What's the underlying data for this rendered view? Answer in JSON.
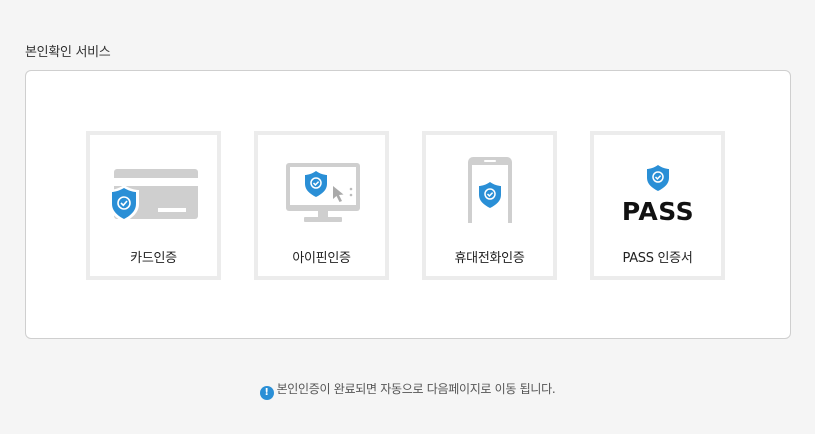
{
  "section_title": "본인확인 서비스",
  "methods": [
    {
      "label": "카드인증",
      "icon": "card-shield-icon"
    },
    {
      "label": "아이핀인증",
      "icon": "monitor-shield-icon"
    },
    {
      "label": "휴대전화인증",
      "icon": "phone-shield-icon"
    },
    {
      "label": "PASS 인증서",
      "icon": "pass-logo-icon"
    }
  ],
  "pass_logo_text": "PASS",
  "notice": {
    "icon": "info-icon",
    "text": "본인인증이 완료되면 자동으로 다음페이지로 이동 됩니다."
  },
  "colors": {
    "shield": "#2a8fd6",
    "device_gray": "#cfcfcf",
    "card_border": "#ececec"
  }
}
